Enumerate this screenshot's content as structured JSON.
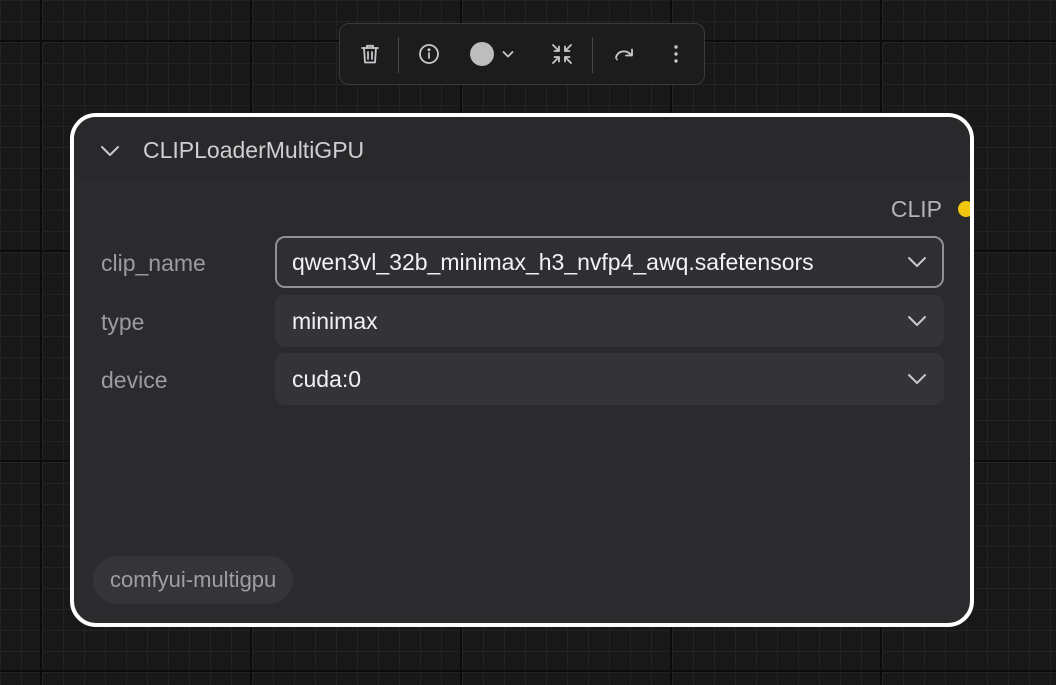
{
  "toolbar": {
    "buttons": [
      {
        "name": "delete",
        "icon": "trash-icon"
      },
      {
        "name": "info",
        "icon": "info-icon"
      },
      {
        "name": "color",
        "icon": "color-dot-icon",
        "color": "#bdbdbd"
      },
      {
        "name": "collapse",
        "icon": "shrink-icon"
      },
      {
        "name": "bypass",
        "icon": "redo-arrow-icon"
      },
      {
        "name": "more",
        "icon": "kebab-menu-icon"
      }
    ]
  },
  "node": {
    "title": "CLIPLoaderMultiGPU",
    "output": {
      "label": "CLIP",
      "color": "#f2c711"
    },
    "widgets": [
      {
        "label": "clip_name",
        "value": "qwen3vl_32b_minimax_h3_nvfp4_awq.safetensors",
        "focused": true
      },
      {
        "label": "type",
        "value": "minimax",
        "focused": false
      },
      {
        "label": "device",
        "value": "cuda:0",
        "focused": false
      }
    ],
    "badge": "comfyui-multigpu",
    "border_color": "#ffffff"
  }
}
